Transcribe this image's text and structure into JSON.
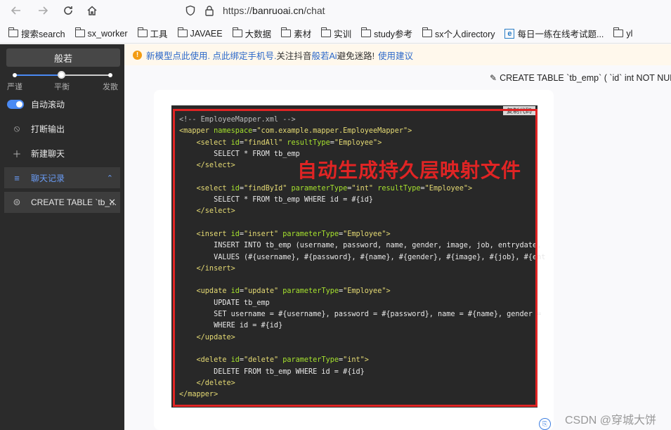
{
  "browser": {
    "url_scheme": "https://",
    "url_host": "banruoai.cn",
    "url_path": "/chat",
    "bookmarks": [
      {
        "label": "搜索search",
        "icon": "folder-icon"
      },
      {
        "label": "sx_worker",
        "icon": "folder-icon"
      },
      {
        "label": "工具",
        "icon": "folder-icon"
      },
      {
        "label": "JAVAEE",
        "icon": "folder-icon"
      },
      {
        "label": "大数据",
        "icon": "folder-icon"
      },
      {
        "label": "素材",
        "icon": "folder-icon"
      },
      {
        "label": "实训",
        "icon": "folder-icon"
      },
      {
        "label": "study参考",
        "icon": "folder-icon"
      },
      {
        "label": "sx个人directory",
        "icon": "folder-icon"
      },
      {
        "label": "每日一练在线考试题...",
        "icon": "e-icon"
      },
      {
        "label": "yl",
        "icon": "folder-icon"
      }
    ]
  },
  "sidebar": {
    "mode_label": "般若",
    "slider": {
      "labels": [
        "严谨",
        "平衡",
        "发散"
      ],
      "value_index": 1
    },
    "auto_scroll_label": "自动滚动",
    "auto_scroll_on": true,
    "stop_output_label": "打断输出",
    "new_chat_label": "新建聊天",
    "history_label": "聊天记录",
    "chat_item_label": "CREATE TABLE `tb_..."
  },
  "notice": {
    "icon": "!",
    "part1": "新模型点此使用. 点此绑定手机号.",
    "part2": "关注抖音",
    "part3": "般若Ai",
    "part4": "避免迷路!",
    "part5": "使用建议"
  },
  "chat": {
    "title": "CREATE TABLE `tb_emp` ( `id` int NOT NUL",
    "copy_label": "复制代码",
    "overlay_annotation": "自动生成持久层映射文件",
    "code_lines": [
      [
        {
          "t": "<!-- EmployeeMapper.xml -->",
          "c": "c-comment"
        }
      ],
      [
        {
          "t": "<mapper ",
          "c": "c-tag"
        },
        {
          "t": "namespace",
          "c": "c-attr"
        },
        {
          "t": "=",
          "c": ""
        },
        {
          "t": "\"com.example.mapper.EmployeeMapper\"",
          "c": "c-str"
        },
        {
          "t": ">",
          "c": "c-tag"
        }
      ],
      [
        {
          "t": "    <select ",
          "c": "c-tag"
        },
        {
          "t": "id",
          "c": "c-attr"
        },
        {
          "t": "=",
          "c": ""
        },
        {
          "t": "\"findAll\"",
          "c": "c-str"
        },
        {
          "t": " resultType",
          "c": "c-attr"
        },
        {
          "t": "=",
          "c": ""
        },
        {
          "t": "\"Employee\"",
          "c": "c-str"
        },
        {
          "t": ">",
          "c": "c-tag"
        }
      ],
      [
        {
          "t": "        SELECT * FROM tb_emp",
          "c": ""
        }
      ],
      [
        {
          "t": "    </select>",
          "c": "c-tag"
        }
      ],
      [
        {
          "t": "",
          "c": ""
        }
      ],
      [
        {
          "t": "    <select ",
          "c": "c-tag"
        },
        {
          "t": "id",
          "c": "c-attr"
        },
        {
          "t": "=",
          "c": ""
        },
        {
          "t": "\"findById\"",
          "c": "c-str"
        },
        {
          "t": " parameterType",
          "c": "c-attr"
        },
        {
          "t": "=",
          "c": ""
        },
        {
          "t": "\"int\"",
          "c": "c-str"
        },
        {
          "t": " resultType",
          "c": "c-attr"
        },
        {
          "t": "=",
          "c": ""
        },
        {
          "t": "\"Employee\"",
          "c": "c-str"
        },
        {
          "t": ">",
          "c": "c-tag"
        }
      ],
      [
        {
          "t": "        SELECT * FROM tb_emp WHERE id = #{id}",
          "c": ""
        }
      ],
      [
        {
          "t": "    </select>",
          "c": "c-tag"
        }
      ],
      [
        {
          "t": "",
          "c": ""
        }
      ],
      [
        {
          "t": "    <insert ",
          "c": "c-tag"
        },
        {
          "t": "id",
          "c": "c-attr"
        },
        {
          "t": "=",
          "c": ""
        },
        {
          "t": "\"insert\"",
          "c": "c-str"
        },
        {
          "t": " parameterType",
          "c": "c-attr"
        },
        {
          "t": "=",
          "c": ""
        },
        {
          "t": "\"Employee\"",
          "c": "c-str"
        },
        {
          "t": ">",
          "c": "c-tag"
        }
      ],
      [
        {
          "t": "        INSERT INTO tb_emp (username, password, name, gender, image, job, entrydate,",
          "c": ""
        }
      ],
      [
        {
          "t": "        VALUES (#{username}, #{password}, #{name}, #{gender}, #{image}, #{job}, #{ent",
          "c": ""
        }
      ],
      [
        {
          "t": "    </insert>",
          "c": "c-tag"
        }
      ],
      [
        {
          "t": "",
          "c": ""
        }
      ],
      [
        {
          "t": "    <update ",
          "c": "c-tag"
        },
        {
          "t": "id",
          "c": "c-attr"
        },
        {
          "t": "=",
          "c": ""
        },
        {
          "t": "\"update\"",
          "c": "c-str"
        },
        {
          "t": " parameterType",
          "c": "c-attr"
        },
        {
          "t": "=",
          "c": ""
        },
        {
          "t": "\"Employee\"",
          "c": "c-str"
        },
        {
          "t": ">",
          "c": "c-tag"
        }
      ],
      [
        {
          "t": "        UPDATE tb_emp",
          "c": ""
        }
      ],
      [
        {
          "t": "        SET username = #{username}, password = #{password}, name = #{name}, gender =",
          "c": ""
        }
      ],
      [
        {
          "t": "        WHERE id = #{id}",
          "c": ""
        }
      ],
      [
        {
          "t": "    </update>",
          "c": "c-tag"
        }
      ],
      [
        {
          "t": "",
          "c": ""
        }
      ],
      [
        {
          "t": "    <delete ",
          "c": "c-tag"
        },
        {
          "t": "id",
          "c": "c-attr"
        },
        {
          "t": "=",
          "c": ""
        },
        {
          "t": "\"delete\"",
          "c": "c-str"
        },
        {
          "t": " parameterType",
          "c": "c-attr"
        },
        {
          "t": "=",
          "c": ""
        },
        {
          "t": "\"int\"",
          "c": "c-str"
        },
        {
          "t": ">",
          "c": "c-tag"
        }
      ],
      [
        {
          "t": "        DELETE FROM tb_emp WHERE id = #{id}",
          "c": ""
        }
      ],
      [
        {
          "t": "    </delete>",
          "c": "c-tag"
        }
      ],
      [
        {
          "t": "</mapper>",
          "c": "c-tag"
        }
      ]
    ]
  },
  "watermark": "CSDN @穿城大饼",
  "colors": {
    "accent": "#4a8af4",
    "annotation": "#e02424",
    "code_bg": "#282828"
  }
}
